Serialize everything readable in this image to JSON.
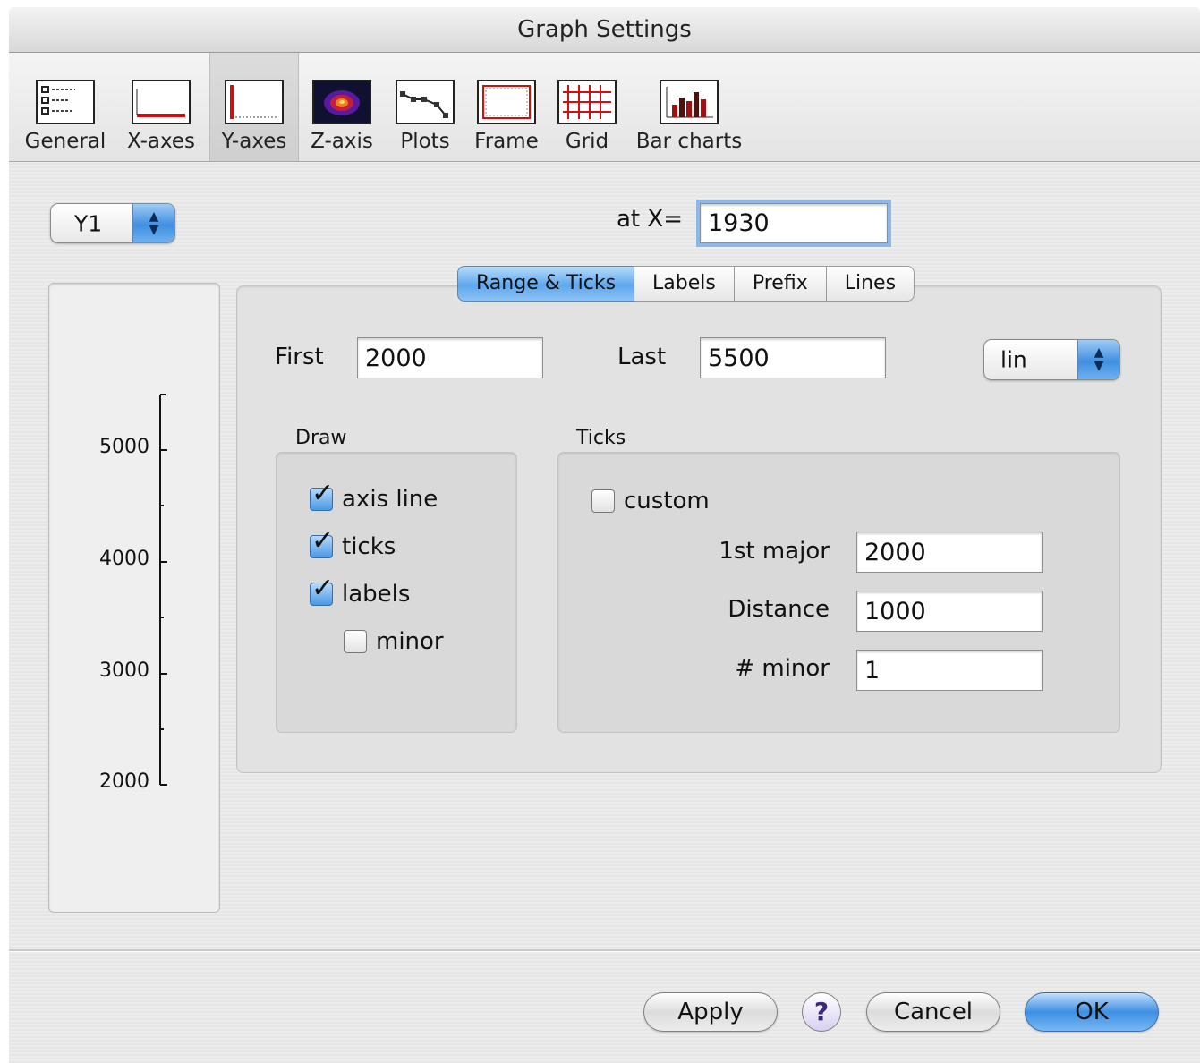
{
  "window": {
    "title": "Graph Settings"
  },
  "toolbar": {
    "items": [
      {
        "label": "General",
        "icon": "general-icon"
      },
      {
        "label": "X-axes",
        "icon": "x-axes-icon"
      },
      {
        "label": "Y-axes",
        "icon": "y-axes-icon",
        "selected": true
      },
      {
        "label": "Z-axis",
        "icon": "z-axis-icon"
      },
      {
        "label": "Plots",
        "icon": "plots-icon"
      },
      {
        "label": "Frame",
        "icon": "frame-icon"
      },
      {
        "label": "Grid",
        "icon": "grid-icon"
      },
      {
        "label": "Bar charts",
        "icon": "bar-charts-icon"
      }
    ]
  },
  "axis_select": {
    "value": "Y1"
  },
  "at_x": {
    "label": "at X=",
    "value": "1930"
  },
  "preview": {
    "tick_labels": [
      "5000",
      "4000",
      "3000",
      "2000"
    ]
  },
  "tabs": [
    {
      "label": "Range & Ticks",
      "active": true
    },
    {
      "label": "Labels"
    },
    {
      "label": "Prefix"
    },
    {
      "label": "Lines"
    }
  ],
  "range": {
    "first_label": "First",
    "first_value": "2000",
    "last_label": "Last",
    "last_value": "5500",
    "scale": "lin"
  },
  "draw": {
    "title": "Draw",
    "axis_line": {
      "label": "axis line",
      "checked": true
    },
    "ticks": {
      "label": "ticks",
      "checked": true
    },
    "labels": {
      "label": "labels",
      "checked": true
    },
    "minor": {
      "label": "minor",
      "checked": false
    }
  },
  "ticks": {
    "title": "Ticks",
    "custom": {
      "label": "custom",
      "checked": false
    },
    "first_major_label": "1st major",
    "first_major_value": "2000",
    "distance_label": "Distance",
    "distance_value": "1000",
    "minor_label": "# minor",
    "minor_value": "1"
  },
  "buttons": {
    "apply": "Apply",
    "help": "?",
    "cancel": "Cancel",
    "ok": "OK"
  },
  "colors": {
    "accent": "#4a98e6"
  }
}
